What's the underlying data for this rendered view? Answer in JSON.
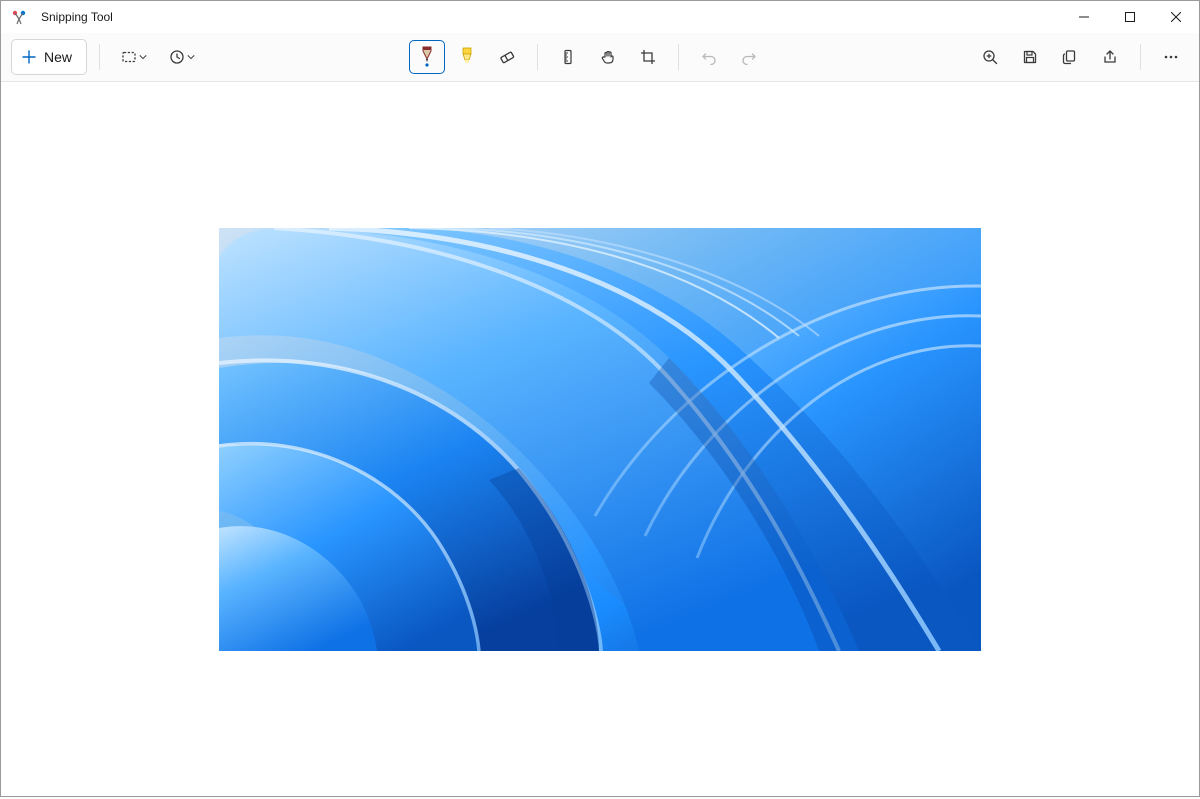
{
  "app": {
    "title": "Snipping Tool"
  },
  "toolbar": {
    "new_label": "New"
  },
  "tools": {
    "pen_selected": true
  }
}
